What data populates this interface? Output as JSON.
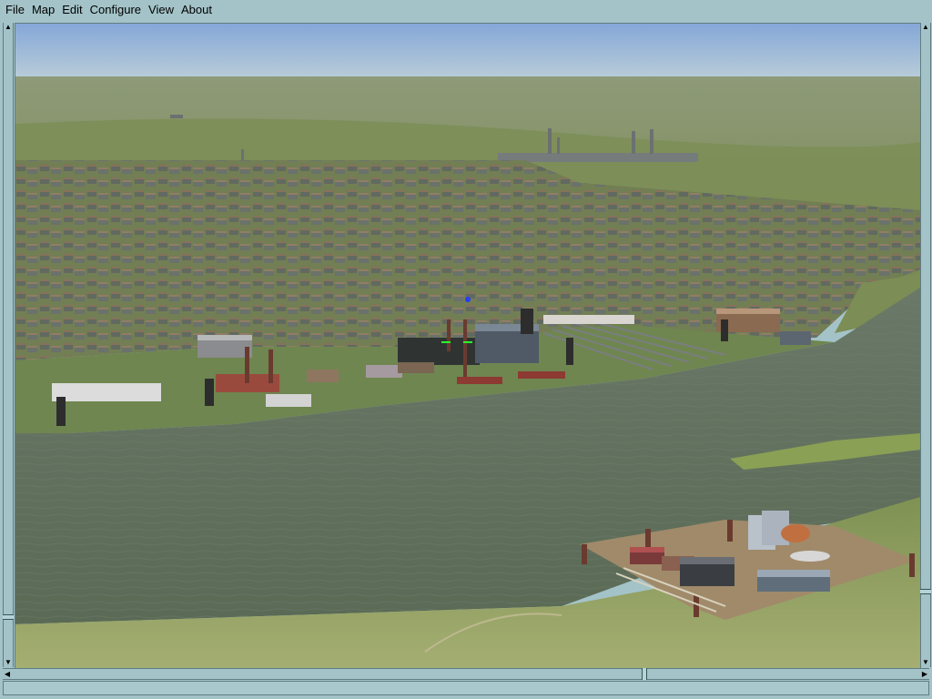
{
  "menu": {
    "items": [
      "File",
      "Map",
      "Edit",
      "Configure",
      "View",
      "About"
    ]
  },
  "viewport": {
    "scene_name": "3d-harbor-city-view"
  },
  "colors": {
    "sky": "#8fb2dc",
    "water": "#5e6f5e",
    "land": "#7c8d55",
    "chrome": "#a3c3c8"
  },
  "statusbar": {
    "text": ""
  }
}
